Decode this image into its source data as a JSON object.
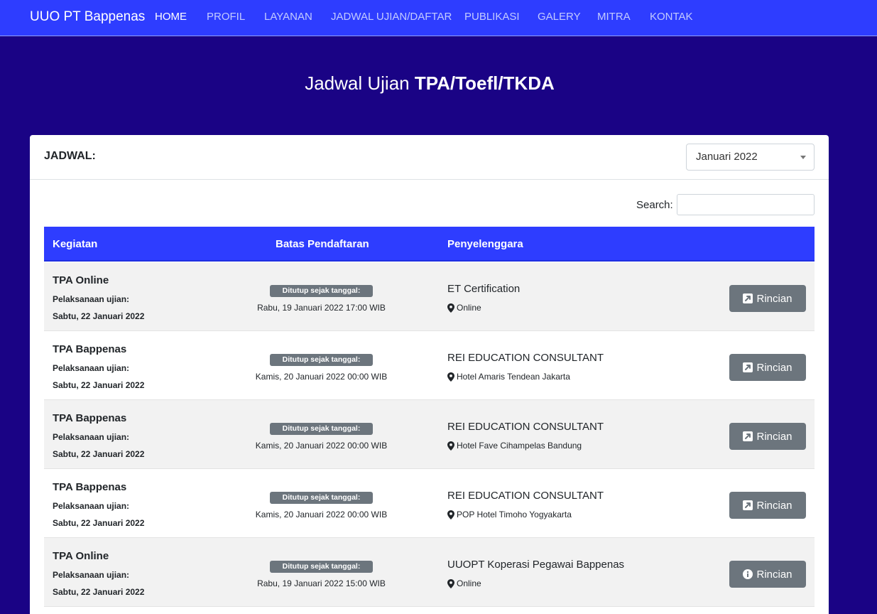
{
  "navbar": {
    "brand": "UUO PT Bappenas",
    "links": [
      "HOME",
      "PROFIL",
      "LAYANAN",
      "JADWAL UJIAN/DAFTAR",
      "PUBLIKASI",
      "GALERY",
      "MITRA",
      "KONTAK"
    ],
    "active": "HOME"
  },
  "page": {
    "title_prefix": "Jadwal Ujian ",
    "title_bold": "TPA/Toefl/TKDA"
  },
  "card": {
    "label": "JADWAL:",
    "month_select": "Januari 2022",
    "search_label": "Search:",
    "search_value": ""
  },
  "table": {
    "headers": [
      "Kegiatan",
      "Batas Pendaftaran",
      "Penyelenggara"
    ],
    "rows": [
      {
        "kegiatan": "TPA Online",
        "pel_label": "Pelaksanaan ujian:",
        "pel_date": "Sabtu, 22 Januari 2022",
        "badge": "Ditutup sejak tanggal:",
        "deadline": "Rabu, 19 Januari 2022 17:00 WIB",
        "org": "ET Certification",
        "loc": "Online",
        "button": "Rincian",
        "button_icon": "external-link-icon"
      },
      {
        "kegiatan": "TPA Bappenas",
        "pel_label": "Pelaksanaan ujian:",
        "pel_date": "Sabtu, 22 Januari 2022",
        "badge": "Ditutup sejak tanggal:",
        "deadline": "Kamis, 20 Januari 2022 00:00 WIB",
        "org": "REI EDUCATION CONSULTANT",
        "loc": "Hotel Amaris Tendean Jakarta",
        "button": "Rincian",
        "button_icon": "external-link-icon"
      },
      {
        "kegiatan": "TPA Bappenas",
        "pel_label": "Pelaksanaan ujian:",
        "pel_date": "Sabtu, 22 Januari 2022",
        "badge": "Ditutup sejak tanggal:",
        "deadline": "Kamis, 20 Januari 2022 00:00 WIB",
        "org": "REI EDUCATION CONSULTANT",
        "loc": "Hotel Fave Cihampelas Bandung",
        "button": "Rincian",
        "button_icon": "external-link-icon"
      },
      {
        "kegiatan": "TPA Bappenas",
        "pel_label": "Pelaksanaan ujian:",
        "pel_date": "Sabtu, 22 Januari 2022",
        "badge": "Ditutup sejak tanggal:",
        "deadline": "Kamis, 20 Januari 2022 00:00 WIB",
        "org": "REI EDUCATION CONSULTANT",
        "loc": "POP Hotel Timoho Yogyakarta",
        "button": "Rincian",
        "button_icon": "external-link-icon"
      },
      {
        "kegiatan": "TPA Online",
        "pel_label": "Pelaksanaan ujian:",
        "pel_date": "Sabtu, 22 Januari 2022",
        "badge": "Ditutup sejak tanggal:",
        "deadline": "Rabu, 19 Januari 2022 15:00 WIB",
        "org": "UUOPT Koperasi Pegawai Bappenas",
        "loc": "Online",
        "button": "Rincian",
        "button_icon": "info-circle-icon"
      }
    ]
  },
  "colors": {
    "background": "#1a0385",
    "navbar": "#2e3dff",
    "table_header": "#2e3dff",
    "button": "#6c757d"
  }
}
